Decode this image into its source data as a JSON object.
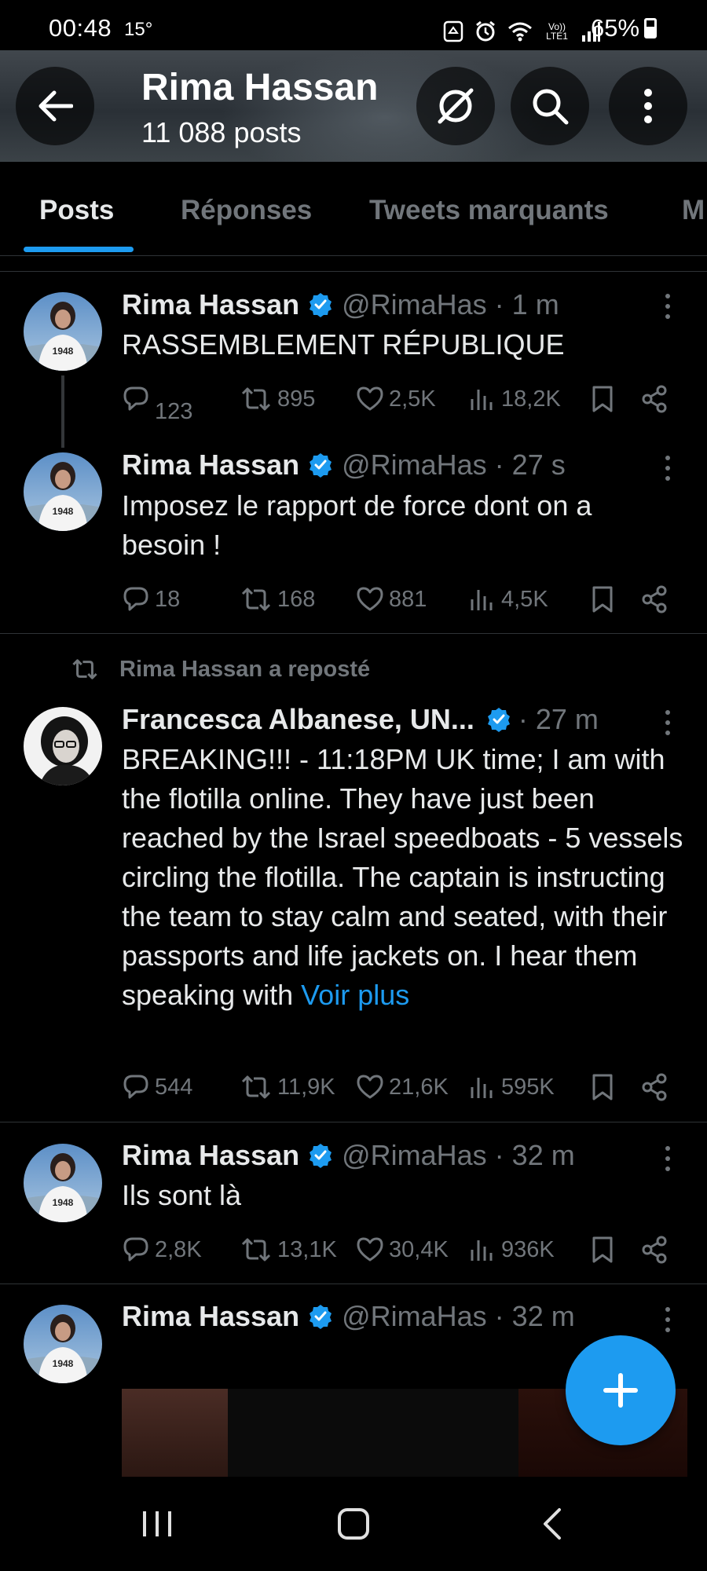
{
  "status_bar": {
    "time": "00:48",
    "temperature": "15°",
    "battery": "65%",
    "network": "Vo)) LTE1"
  },
  "header": {
    "title": "Rima Hassan",
    "subtitle": "11 088 posts"
  },
  "tabs": [
    {
      "label": "Posts",
      "active": true
    },
    {
      "label": "Réponses",
      "active": false
    },
    {
      "label": "Tweets marquants",
      "active": false
    },
    {
      "label": "M",
      "active": false
    }
  ],
  "posts": [
    {
      "name": "Rima Hassan",
      "handle": "@RimaHas · 1 m",
      "text": "RASSEMBLEMENT RÉPUBLIQUE",
      "replies": "123",
      "reposts": "895",
      "likes": "2,5K",
      "views": "18,2K"
    },
    {
      "name": "Rima Hassan",
      "handle": "@RimaHas · 27 s",
      "text": "Imposez le rapport de force dont on a besoin !",
      "replies": "18",
      "reposts": "168",
      "likes": "881",
      "views": "4,5K"
    },
    {
      "repost_label": "Rima Hassan a reposté",
      "name": "Francesca Albanese, UN...",
      "handle": "· 27 m",
      "text": "BREAKING!!! - 11:18PM UK time; I am with the flotilla online. They have just been reached by the Israel speedboats - 5 vessels circling the flotilla. The captain is instructing the team to stay calm and seated, with their passports and life jackets on. I hear them speaking with",
      "more_link": "Voir plus",
      "replies": "544",
      "reposts": "11,9K",
      "likes": "21,6K",
      "views": "595K"
    },
    {
      "name": "Rima Hassan",
      "handle": "@RimaHas · 32 m",
      "text": "Ils sont là",
      "replies": "2,8K",
      "reposts": "13,1K",
      "likes": "30,4K",
      "views": "936K"
    },
    {
      "name": "Rima Hassan",
      "handle": "@RimaHas · 32 m"
    }
  ],
  "avatar_badge": "1948",
  "colors": {
    "accent": "#1d9bf0",
    "muted": "#71767b",
    "text": "#e7e9ea",
    "background": "#000000",
    "divider": "#2f3336"
  }
}
